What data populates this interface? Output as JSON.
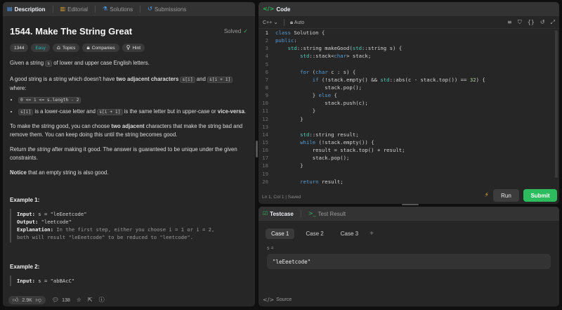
{
  "left": {
    "tabs": [
      {
        "label": "Description",
        "icon": "file-icon"
      },
      {
        "label": "Editorial",
        "icon": "book-icon"
      },
      {
        "label": "Solutions",
        "icon": "flask-icon"
      },
      {
        "label": "Submissions",
        "icon": "history-icon"
      }
    ],
    "title": "1544. Make The String Great",
    "solved": "Solved",
    "badges": {
      "number": "1344",
      "difficulty": "Easy",
      "topics": "Topics",
      "companies": "Companies",
      "hint": "Hint"
    },
    "desc": {
      "p1a": "Given a string ",
      "p1code": "s",
      "p1b": " of lower and upper case English letters.",
      "p2a": "A good string is a string which doesn't have ",
      "p2bold": "two adjacent characters",
      "p2code1": "s[i]",
      "p2and": " and ",
      "p2code2": "s[i + 1]",
      "p2b": "where:",
      "b1code": "0 <= i <= s.length - 2",
      "b2code1": "s[i]",
      "b2a": " is a lower-case letter and ",
      "b2code2": "s[i + 1]",
      "b2b": " is the same letter but in upper-case or ",
      "b2bold": "vice-versa",
      "b2c": ".",
      "p3a": "To make the string good, you can choose ",
      "p3bold": "two adjacent",
      "p3b": " characters that make the string bad and remove them. You can keep doing this until the string becomes good.",
      "p4a": "Return ",
      "p4em": "the string",
      "p4b": " after making it good. The answer is guaranteed to be unique under the given constraints.",
      "p5bold": "Notice",
      "p5b": " that an empty string is also good."
    },
    "example1": {
      "title": "Example 1:",
      "input_label": "Input:",
      "input": " s = \"leEeetcode\"",
      "output_label": "Output:",
      "output": " \"leetcode\"",
      "expl_label": "Explanation:",
      "expl1": " In the first step, either you choose i = 1 or i = 2,",
      "expl2": "both will result \"leEeetcode\" to be reduced to \"leetcode\"."
    },
    "example2": {
      "title": "Example 2:",
      "input_label": "Input:",
      "input": " s = \"abBAcC\""
    },
    "footer": {
      "likes": "2.9K",
      "comments": "138"
    }
  },
  "code": {
    "tab": "Code",
    "language": "C++",
    "auto": "Auto",
    "lines": [
      "class Solution {",
      "public:",
      "    std::string makeGood(std::string s) {",
      "        std::stack<char> stack;",
      "",
      "        for (char c : s) {",
      "            if (!stack.empty() && std::abs(c - stack.top()) == 32) {",
      "                stack.pop();",
      "            } else {",
      "                stack.push(c);",
      "            }",
      "        }",
      "",
      "        std::string result;",
      "        while (!stack.empty()) {",
      "            result = stack.top() + result;",
      "            stack.pop();",
      "        }",
      "",
      "        return result;"
    ],
    "status": "Ln 1, Col 1  |  Saved",
    "run": "Run",
    "submit": "Submit"
  },
  "testcase": {
    "tabs": [
      {
        "label": "Testcase",
        "icon": "check-square-icon"
      },
      {
        "label": "Test Result",
        "icon": "terminal-icon"
      }
    ],
    "cases": [
      "Case 1",
      "Case 2",
      "Case 3"
    ],
    "var_label": "s =",
    "var_value": "\"leEeetcode\"",
    "source": "Source"
  }
}
